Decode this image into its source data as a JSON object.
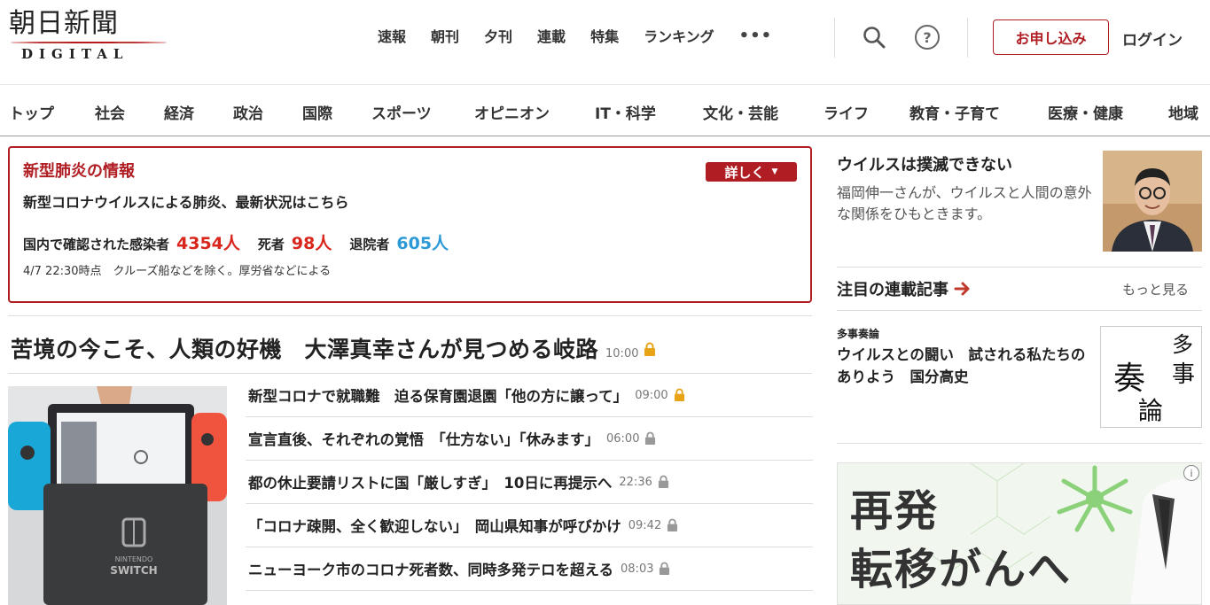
{
  "header": {
    "logo_main": "朝日新聞",
    "logo_sub": "DIGITAL",
    "top_nav": [
      "速報",
      "朝刊",
      "夕刊",
      "連載",
      "特集",
      "ランキング"
    ],
    "more_label": "•••",
    "help_label": "?",
    "subscribe_label": "お申し込み",
    "login_label": "ログイン"
  },
  "categories": [
    "トップ",
    "社会",
    "経済",
    "政治",
    "国際",
    "スポーツ",
    "オピニオン",
    "IT・科学",
    "文化・芸能",
    "ライフ",
    "教育・子育て",
    "医療・健康",
    "地域"
  ],
  "corona": {
    "title": "新型肺炎の情報",
    "detail_label": "詳しく",
    "detail_icon": "▼",
    "subtitle": "新型コロナウイルスによる肺炎、最新状況はこちら",
    "infected_label": "国内で確認された感染者",
    "infected_value": "4354人",
    "deaths_label": "死者",
    "deaths_value": "98人",
    "discharged_label": "退院者",
    "discharged_value": "605人",
    "note": "4/7 22:30時点　クルーズ船などを除く。厚労省などによる"
  },
  "headline": {
    "title": "苦境の今こそ、人類の好機　大澤真幸さんが見つめる岐路",
    "time": "10:00",
    "lock": "gold"
  },
  "articles": [
    {
      "title": "新型コロナで就職難　迫る保育園退園「他の方に譲って」",
      "time": "09:00",
      "lock": "gold"
    },
    {
      "title": "宣言直後、それぞれの覚悟　「仕方ない」「休みます」",
      "time": "06:00",
      "lock": "gray"
    },
    {
      "title": "都の休止要請リストに国「厳しすぎ」　10日に再提示へ",
      "time": "22:36",
      "lock": "gray"
    },
    {
      "title": "「コロナ疎開、全く歓迎しない」　岡山県知事が呼びかけ",
      "time": "09:42",
      "lock": "gray"
    },
    {
      "title": "ニューヨーク市のコロナ死者数、同時多発テロを超える",
      "time": "08:03",
      "lock": "gray"
    }
  ],
  "feature": {
    "title": "ウイルスは撲滅できない",
    "description": "福岡伸一さんが、ウイルスと人間の意外な関係をひもときます。"
  },
  "series": {
    "heading": "注目の連載記事",
    "more_label": "もっと見る",
    "category": "多事奏論",
    "title": "ウイルスとの闘い　試される私たちのありよう　国分高史",
    "image_text": "多事奏論"
  },
  "ad": {
    "line1": "再発",
    "line2": "転移がんへ",
    "info_icon": "i"
  },
  "colors": {
    "brand_red": "#b01e23",
    "stat_red": "#d9261c",
    "stat_blue": "#2b9ad6",
    "lock_gold": "#e8a317",
    "lock_gray": "#999999"
  }
}
